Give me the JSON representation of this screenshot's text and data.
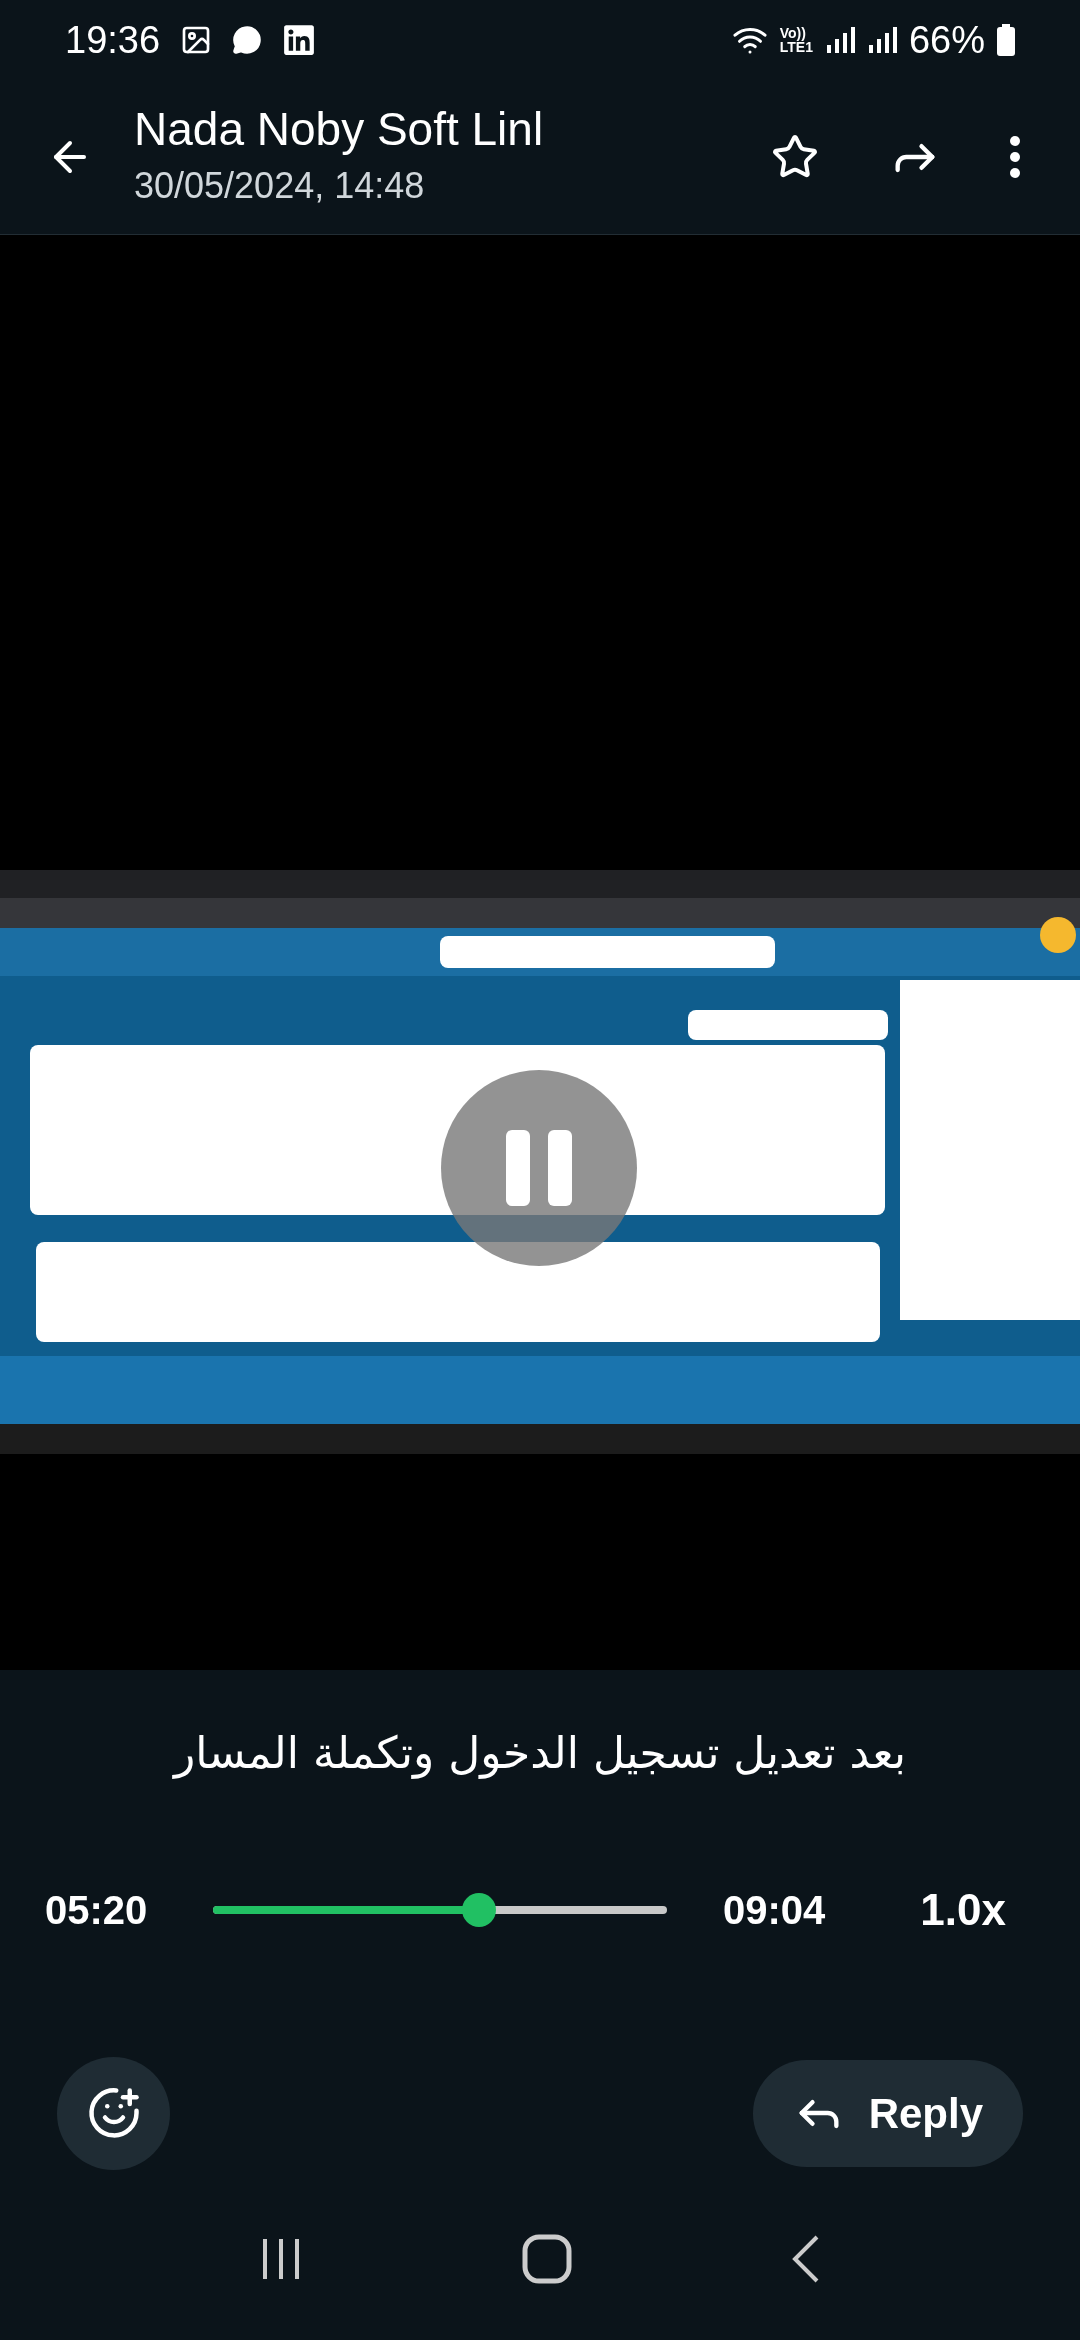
{
  "status_bar": {
    "time": "19:36",
    "network_top": "Vo))",
    "network_bottom": "LTE1",
    "battery": "66%"
  },
  "header": {
    "title": "Nada Noby Soft Linl",
    "subtitle": "30/05/2024, 14:48",
    "starred": false
  },
  "video": {
    "playing": true
  },
  "caption": "بعد تعديل تسجيل الدخول وتكملة المسار",
  "player": {
    "elapsed": "05:20",
    "level": 0.585,
    "duration": "09:04",
    "speed": "1.0x"
  },
  "reply": {
    "label": "Reply"
  }
}
